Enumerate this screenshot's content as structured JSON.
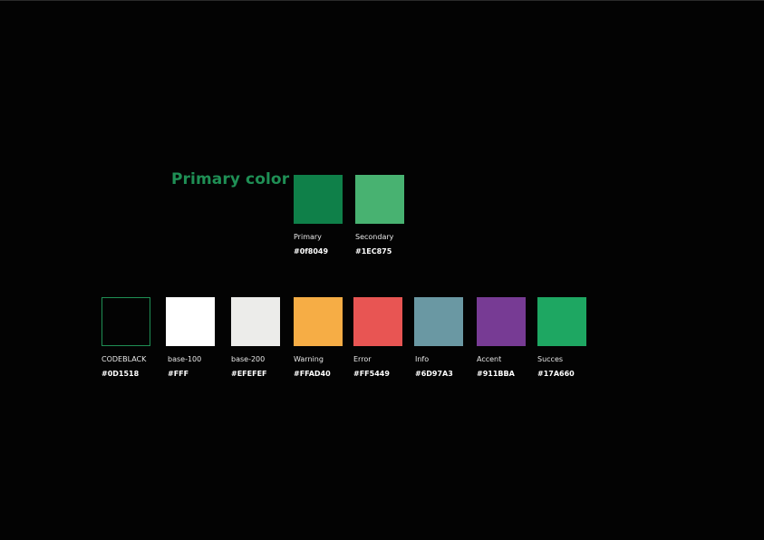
{
  "title": "Primary color",
  "title_color": "#1F8F55",
  "primary_swatches": [
    {
      "name": "Primary",
      "hex": "#0f8049",
      "color": "#0f8049"
    },
    {
      "name": "Secondary",
      "hex": "#1EC875",
      "color": "#48b271"
    }
  ],
  "palette_swatches": [
    {
      "name": "CODEBLACK",
      "hex": "#0D1518",
      "color": "#030303",
      "outline": "#1f8f55"
    },
    {
      "name": "base-100",
      "hex": "#FFF",
      "color": "#ffffff"
    },
    {
      "name": "base-200",
      "hex": "#EFEFEF",
      "color": "#ececea"
    },
    {
      "name": "Warning",
      "hex": "#FFAD40",
      "color": "#f6ad45"
    },
    {
      "name": "Error",
      "hex": "#FF5449",
      "color": "#e85553"
    },
    {
      "name": "Info",
      "hex": "#6D97A3",
      "color": "#6a98a3"
    },
    {
      "name": "Accent",
      "hex": "#911BBA",
      "color": "#773b94"
    },
    {
      "name": "Succes",
      "hex": "#17A660",
      "color": "#1ea762"
    }
  ]
}
